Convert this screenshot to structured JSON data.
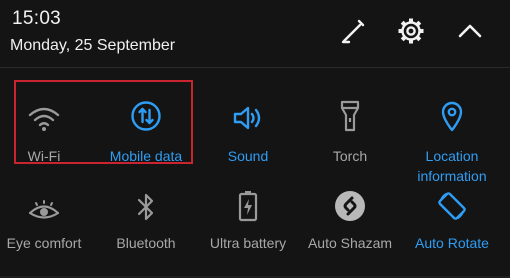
{
  "status": {
    "time": "15:03",
    "date": "Monday, 25 September"
  },
  "header_icons": [
    "edit-pencil-icon",
    "settings-gear-icon",
    "collapse-chevron-up-icon"
  ],
  "colors": {
    "active": "#2f9df4",
    "inactive": "#a8a8a8",
    "background": "#141414",
    "highlight": "#c9242f"
  },
  "tiles": [
    {
      "label": "Wi-Fi",
      "icon": "wifi-icon",
      "active": false
    },
    {
      "label": "Mobile data",
      "icon": "mobile-data-icon",
      "active": true
    },
    {
      "label": "Sound",
      "icon": "speaker-icon",
      "active": true
    },
    {
      "label": "Torch",
      "icon": "torch-icon",
      "active": false
    },
    {
      "label": "Location information",
      "icon": "location-pin-icon",
      "active": true
    },
    {
      "label": "Eye comfort",
      "icon": "eye-icon",
      "active": false
    },
    {
      "label": "Bluetooth",
      "icon": "bluetooth-icon",
      "active": false
    },
    {
      "label": "Ultra battery",
      "icon": "battery-icon",
      "active": false
    },
    {
      "label": "Auto Shazam",
      "icon": "shazam-icon",
      "active": false
    },
    {
      "label": "Auto Rotate",
      "icon": "auto-rotate-icon",
      "active": true
    }
  ]
}
